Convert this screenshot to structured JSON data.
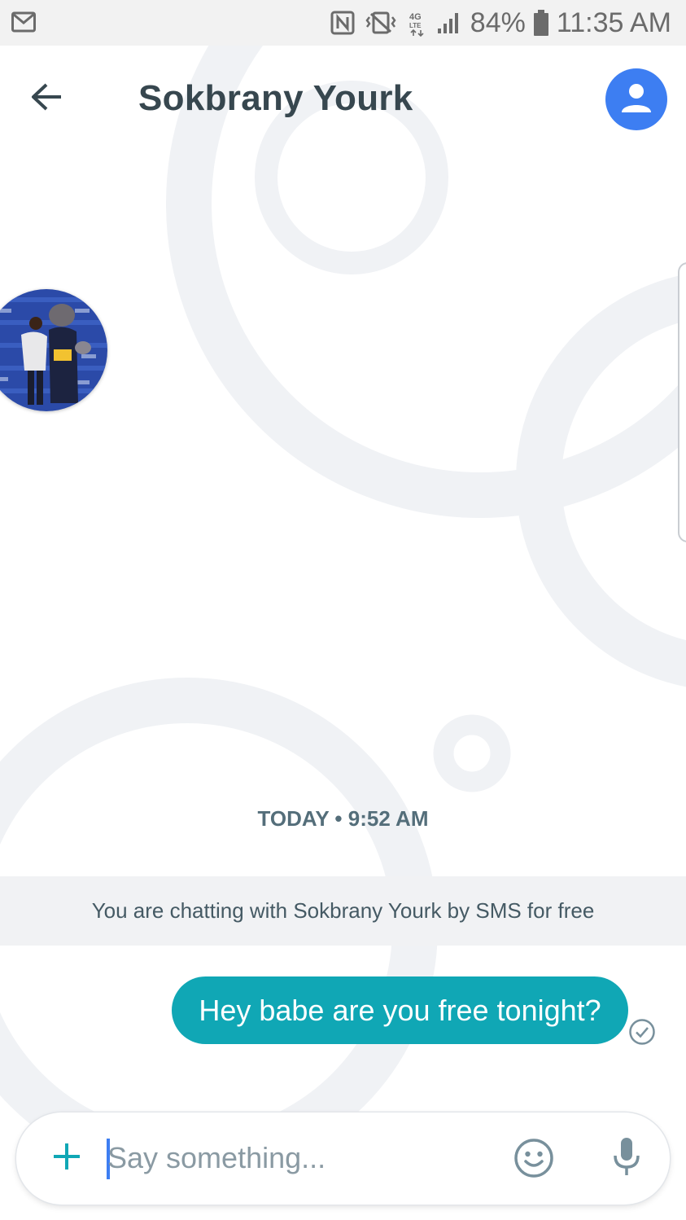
{
  "status_bar": {
    "battery": "84%",
    "time": "11:35 AM",
    "icons": [
      "gmail-icon",
      "nfc-icon",
      "vibrate-icon",
      "4g-lte-icon",
      "signal-icon",
      "battery-icon"
    ]
  },
  "header": {
    "title": "Sokbrany Yourk",
    "back_icon": "arrow-left-icon",
    "avatar_icon": "person-icon"
  },
  "conversation": {
    "date_label": "TODAY • 9:52 AM",
    "info_banner": "You are chatting with Sokbrany Yourk by SMS for free",
    "messages": [
      {
        "direction": "outgoing",
        "text": "Hey babe are you free tonight?",
        "status_icon": "check-circle-icon"
      }
    ]
  },
  "composer": {
    "placeholder": "Say something...",
    "value": "",
    "add_icon": "plus-icon",
    "emoji_icon": "smiley-icon",
    "mic_icon": "microphone-icon"
  },
  "colors": {
    "accent": "#3d7ef2",
    "bubble": "#10a7b5",
    "title": "#37474f",
    "banner_bg": "#f1f2f4"
  }
}
